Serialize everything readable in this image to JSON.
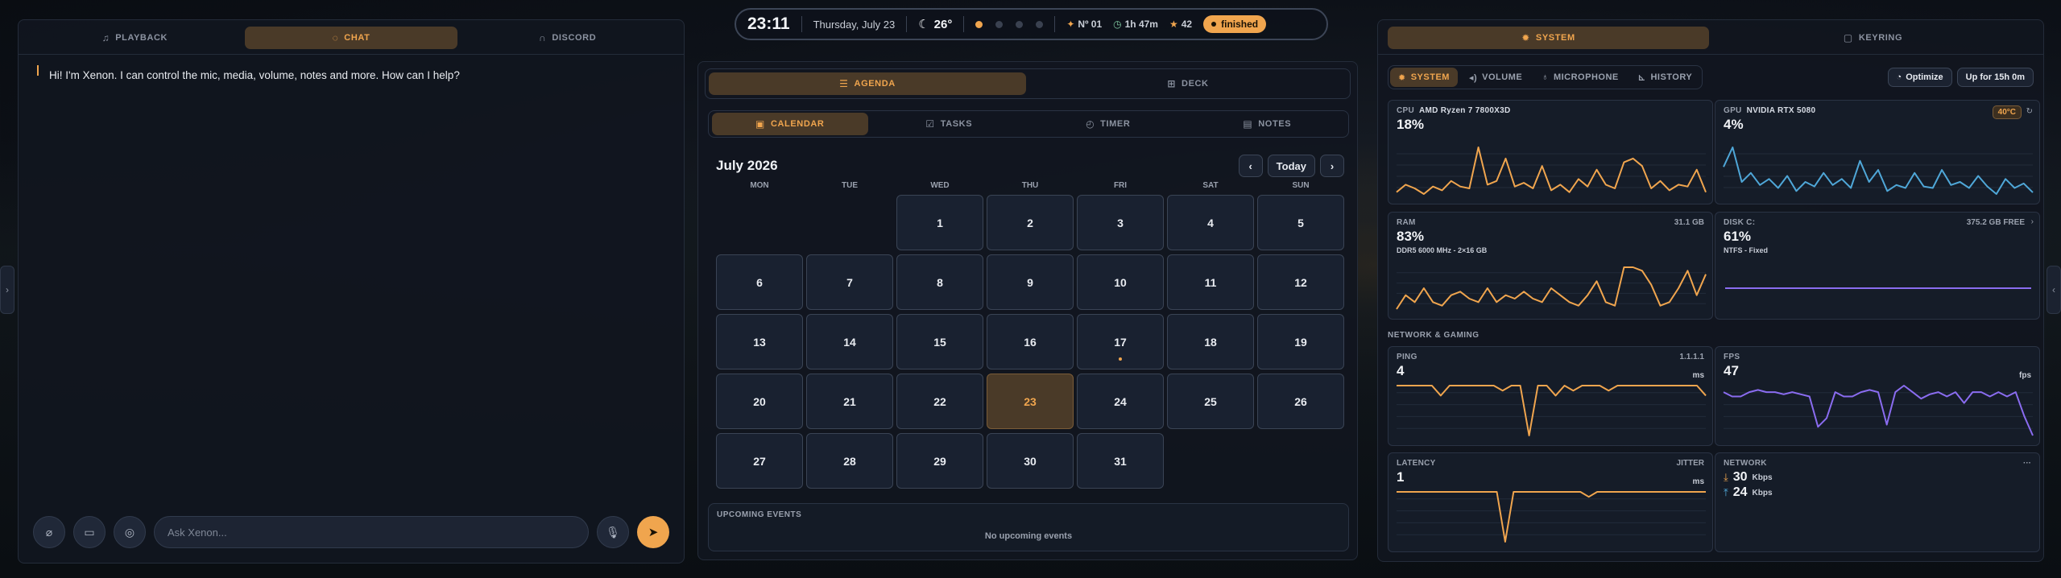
{
  "colors": {
    "accent": "#f0a54e",
    "blue": "#4fa7d8",
    "purple": "#8a6cf0",
    "bg": "#0d1118"
  },
  "topbar": {
    "time": "23:11",
    "date": "Thursday, July 23",
    "weather_icon": "moon-icon",
    "temperature": "26°",
    "dots_active": 1,
    "dots_total": 4,
    "number": "Nº 01",
    "duration": "1h 47m",
    "stars": "42",
    "status": "finished"
  },
  "chat": {
    "tabs": [
      {
        "label": "PLAYBACK",
        "icon": "music-icon"
      },
      {
        "label": "CHAT",
        "icon": "chat-icon",
        "active": true
      },
      {
        "label": "DISCORD",
        "icon": "headset-icon"
      }
    ],
    "message": "Hi! I'm Xenon. I can control the mic, media, volume, notes and more. How can I help?",
    "input_placeholder": "Ask Xenon...",
    "left_buttons": [
      "paperclip-icon",
      "monitor-icon",
      "chat-bubble-icon"
    ],
    "mic_icon": "microphone-icon",
    "send_icon": "send-icon"
  },
  "agenda": {
    "tabs": [
      {
        "label": "AGENDA",
        "icon": "list-icon",
        "active": true
      },
      {
        "label": "DECK",
        "icon": "grid-icon"
      }
    ],
    "subtabs": [
      {
        "label": "CALENDAR",
        "icon": "calendar-icon",
        "active": true
      },
      {
        "label": "TASKS",
        "icon": "checkbox-icon"
      },
      {
        "label": "TIMER",
        "icon": "stopwatch-icon"
      },
      {
        "label": "NOTES",
        "icon": "note-icon"
      }
    ],
    "month": "July 2026",
    "today_label": "Today",
    "prev": "‹",
    "next": "›",
    "weekdays": [
      "MON",
      "TUE",
      "WED",
      "THU",
      "FRI",
      "SAT",
      "SUN"
    ],
    "first_weekday_index": 2,
    "days_in_month": 31,
    "today": 23,
    "event_days": [
      17
    ],
    "upcoming_title": "UPCOMING EVENTS",
    "upcoming_empty": "No upcoming events"
  },
  "system": {
    "tabs": [
      {
        "label": "SYSTEM",
        "icon": "gear-icon",
        "active": true
      },
      {
        "label": "KEYRING",
        "icon": "key-icon"
      }
    ],
    "subtabs": [
      {
        "label": "SYSTEM",
        "icon": "gear-icon",
        "active": true
      },
      {
        "label": "VOLUME",
        "icon": "volume-icon"
      },
      {
        "label": "MICROPHONE",
        "icon": "microphone-icon"
      },
      {
        "label": "HISTORY",
        "icon": "history-icon"
      }
    ],
    "optimize_label": "Optimize",
    "uptime": "Up for 15h 0m",
    "cpu": {
      "label": "CPU",
      "model": "AMD Ryzen 7 7800X3D",
      "value": "18%",
      "series": [
        6,
        10,
        8,
        5,
        9,
        7,
        12,
        9,
        8,
        30,
        10,
        12,
        24,
        9,
        11,
        8,
        20,
        7,
        10,
        6,
        13,
        9,
        18,
        10,
        8,
        22,
        24,
        20,
        8,
        12,
        7,
        10,
        9,
        18,
        6
      ]
    },
    "gpu": {
      "label": "GPU",
      "model": "NVIDIA RTX 5080",
      "value": "4%",
      "temp": "40°C",
      "series": [
        22,
        35,
        12,
        18,
        10,
        14,
        8,
        16,
        6,
        12,
        9,
        18,
        10,
        14,
        8,
        26,
        12,
        20,
        6,
        10,
        8,
        18,
        9,
        8,
        20,
        10,
        12,
        8,
        16,
        9,
        4,
        14,
        8,
        11,
        5
      ]
    },
    "ram": {
      "label": "RAM",
      "value": "83%",
      "detail": "DDR5 6000 MHz - 2×16 GB",
      "total": "31.1 GB",
      "series": [
        80,
        84,
        82,
        86,
        82,
        81,
        84,
        85,
        83,
        82,
        86,
        82,
        84,
        83,
        85,
        83,
        82,
        86,
        84,
        82,
        81,
        84,
        88,
        82,
        81,
        92,
        92,
        91,
        87,
        81,
        82,
        86,
        91,
        84,
        90
      ]
    },
    "disk": {
      "label": "DISK C:",
      "value": "61%",
      "detail": "NTFS - Fixed",
      "free": "375.2 GB FREE"
    },
    "section_title": "NETWORK & GAMING",
    "ping": {
      "label": "PING",
      "value": "4",
      "unit": "ms",
      "server": "1.1.1.1",
      "series": [
        4,
        4,
        4,
        4,
        4,
        2,
        4,
        4,
        4,
        4,
        4,
        4,
        3,
        4,
        4,
        -6,
        4,
        4,
        2,
        4,
        3,
        4,
        4,
        4,
        3,
        4,
        4,
        4,
        4,
        4,
        4,
        4,
        4,
        4,
        4,
        2
      ]
    },
    "fps": {
      "label": "FPS",
      "value": "47",
      "unit": "fps",
      "series": [
        52,
        50,
        50,
        52,
        53,
        52,
        52,
        51,
        52,
        51,
        50,
        36,
        40,
        52,
        50,
        50,
        52,
        53,
        52,
        37,
        52,
        55,
        52,
        49,
        51,
        52,
        50,
        52,
        47,
        52,
        52,
        50,
        52,
        50,
        52,
        41,
        32
      ]
    },
    "latency": {
      "label": "LATENCY",
      "value": "1",
      "unit": "ms",
      "right": "JITTER",
      "series": [
        2,
        2,
        2,
        2,
        2,
        2,
        2,
        2,
        2,
        2,
        2,
        2,
        2,
        -8,
        2,
        2,
        2,
        2,
        2,
        2,
        2,
        2,
        2,
        1,
        2,
        2,
        2,
        2,
        2,
        2,
        2,
        2,
        2,
        2,
        2,
        2,
        2,
        2
      ]
    },
    "network": {
      "label": "NETWORK",
      "down": "30",
      "up": "24",
      "unit": "Kbps",
      "menu": "···"
    }
  }
}
